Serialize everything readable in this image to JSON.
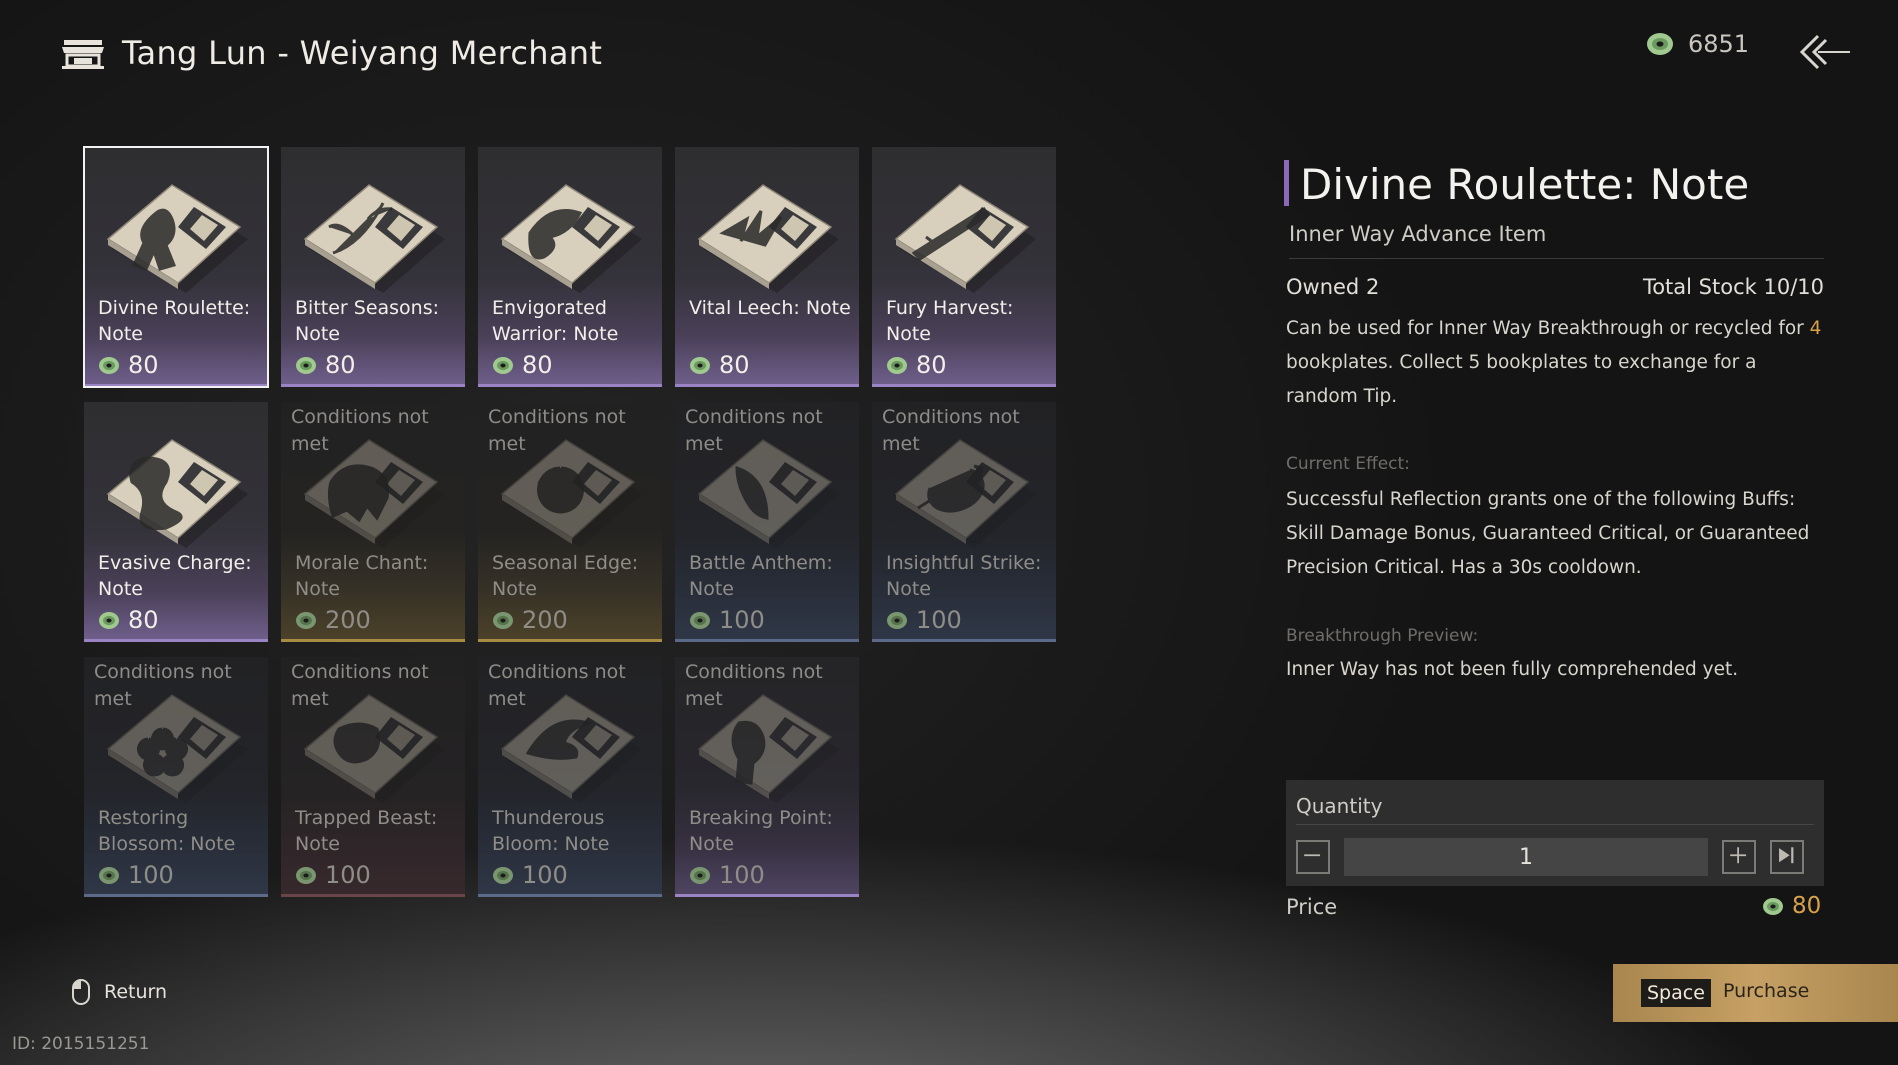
{
  "header": {
    "title": "Tang Lun - Weiyang Merchant",
    "icon": "shop-awning-icon"
  },
  "currency": {
    "icon": "jade-coin-icon",
    "amount": "6851"
  },
  "back_icon": "double-chevron-back-icon",
  "items": [
    {
      "name": "Divine Roulette: Note",
      "price": "80",
      "condition": "",
      "selected": true,
      "accent": "purple",
      "art": "figure"
    },
    {
      "name": "Bitter Seasons: Note",
      "price": "80",
      "condition": "",
      "selected": false,
      "accent": "purple",
      "art": "branch"
    },
    {
      "name": "Envigorated Warrior: Note",
      "price": "80",
      "condition": "",
      "selected": false,
      "accent": "purple",
      "art": "bird-fist"
    },
    {
      "name": "Vital Leech: Note",
      "price": "80",
      "condition": "",
      "selected": false,
      "accent": "purple",
      "art": "swallows"
    },
    {
      "name": "Fury Harvest: Note",
      "price": "80",
      "condition": "",
      "selected": false,
      "accent": "purple",
      "art": "sword"
    },
    {
      "name": "Evasive Charge: Note",
      "price": "80",
      "condition": "",
      "selected": false,
      "accent": "purple",
      "art": "dragon"
    },
    {
      "name": "Morale Chant: Note",
      "price": "200",
      "condition": "Conditions not met",
      "selected": false,
      "accent": "gold",
      "art": "beast"
    },
    {
      "name": "Seasonal Edge: Note",
      "price": "200",
      "condition": "Conditions not met",
      "selected": false,
      "accent": "gold",
      "art": "circle"
    },
    {
      "name": "Battle Anthem: Note",
      "price": "100",
      "condition": "Conditions not met",
      "selected": false,
      "accent": "navy",
      "art": "feather"
    },
    {
      "name": "Insightful Strike: Note",
      "price": "100",
      "condition": "Conditions not met",
      "selected": false,
      "accent": "navy",
      "art": "arrow"
    },
    {
      "name": "Restoring Blossom: Note",
      "price": "100",
      "condition": "Conditions not met",
      "selected": false,
      "accent": "navy",
      "art": "flower"
    },
    {
      "name": "Trapped Beast: Note",
      "price": "100",
      "condition": "Conditions not met",
      "selected": false,
      "accent": "red",
      "art": "tiger"
    },
    {
      "name": "Thunderous Bloom: Note",
      "price": "100",
      "condition": "Conditions not met",
      "selected": false,
      "accent": "navy",
      "art": "bird"
    },
    {
      "name": "Breaking Point: Note",
      "price": "100",
      "condition": "Conditions not met",
      "selected": false,
      "accent": "purple",
      "art": "fist"
    }
  ],
  "detail": {
    "title": "Divine Roulette: Note",
    "subtitle": "Inner Way Advance Item",
    "owned": "Owned 2",
    "stock": "Total Stock 10/10",
    "desc_before": "Can be used for Inner Way Breakthrough or recycled for ",
    "desc_highlight": "4",
    "desc_after": " bookplates. Collect 5 bookplates to exchange for a random Tip.",
    "effect_heading": "Current Effect:",
    "effect_text": "Successful Reflection grants one of the following Buffs: Skill Damage Bonus, Guaranteed Critical, or Guaranteed Precision Critical. Has a 30s cooldown.",
    "preview_heading": "Breakthrough Preview:",
    "preview_text": "Inner Way has not been fully comprehended yet."
  },
  "quantity": {
    "label": "Quantity",
    "value": "1",
    "minus_icon": "minus-icon",
    "plus_icon": "plus-icon",
    "max_icon": "skip-to-max-icon"
  },
  "price": {
    "label": "Price",
    "value": "80"
  },
  "purchase": {
    "key": "Space",
    "label": "Purchase"
  },
  "footer": {
    "return_label": "Return",
    "mouse_icon": "mouse-icon",
    "id_text": "ID: 2015151251"
  },
  "colors": {
    "accent_purple": "#9b84c4",
    "highlight_gold": "#d7a24a",
    "purchase_gold": "#c6a064"
  }
}
